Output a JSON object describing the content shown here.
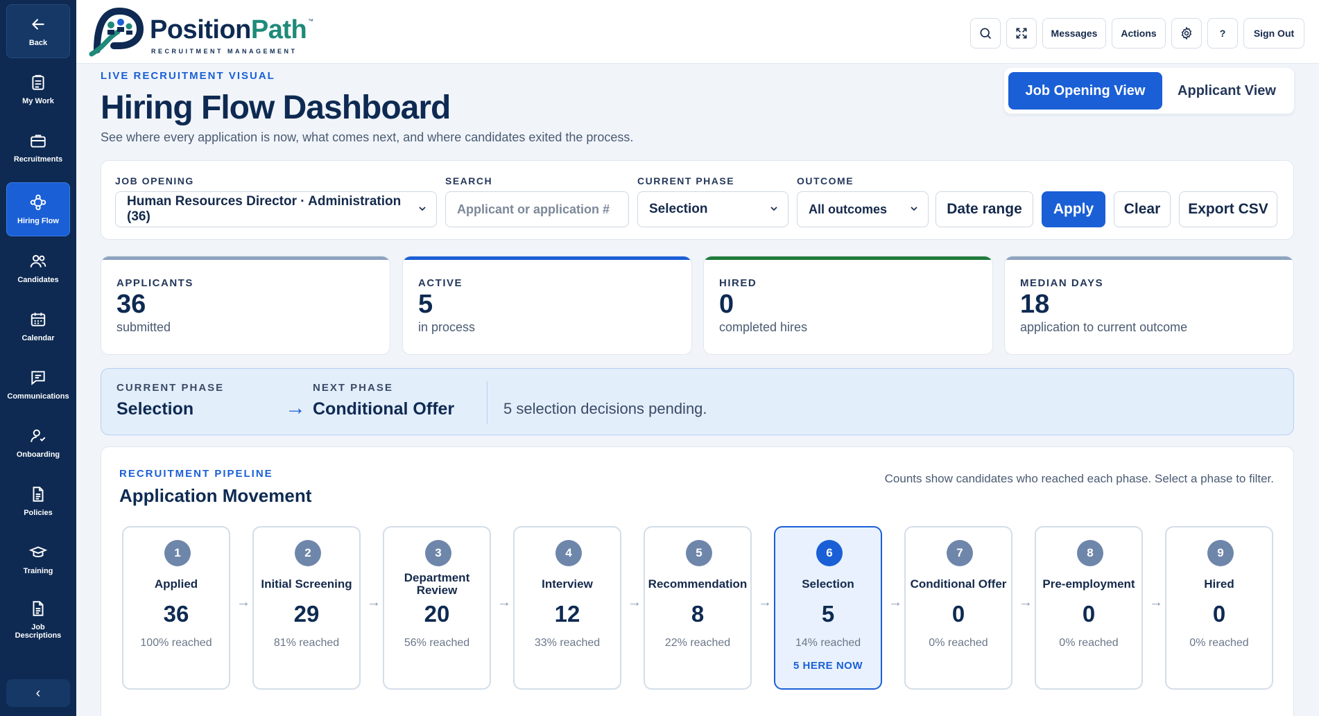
{
  "brand": {
    "name_part1": "Position",
    "name_part2": "Path",
    "trademark": "™",
    "tagline": "RECRUITMENT MANAGEMENT",
    "colors": {
      "navy": "#0e2a52",
      "teal": "#1f8a7a",
      "accent_blue": "#1a5fd6"
    }
  },
  "sidebar": {
    "items": [
      {
        "label": "Back",
        "icon": "arrow-left-icon"
      },
      {
        "label": "My Work",
        "icon": "clipboard-icon"
      },
      {
        "label": "Recruitments",
        "icon": "briefcase-icon"
      },
      {
        "label": "Hiring Flow",
        "icon": "flow-nodes-icon",
        "active": true
      },
      {
        "label": "Candidates",
        "icon": "users-icon"
      },
      {
        "label": "Calendar",
        "icon": "calendar-icon"
      },
      {
        "label": "Communications",
        "icon": "chat-icon"
      },
      {
        "label": "Onboarding",
        "icon": "user-check-icon"
      },
      {
        "label": "Policies",
        "icon": "document-icon"
      },
      {
        "label": "Training",
        "icon": "graduation-cap-icon"
      },
      {
        "label": "Job Descriptions",
        "icon": "document-icon"
      }
    ],
    "collapse_glyph": "‹"
  },
  "header": {
    "messages_label": "Messages",
    "actions_label": "Actions",
    "help_label": "?",
    "signout_label": "Sign Out"
  },
  "page": {
    "eyebrow": "LIVE RECRUITMENT VISUAL",
    "title": "Hiring Flow Dashboard",
    "subtitle": "See where every application is now, what comes next, and where candidates exited the process."
  },
  "view_toggle": {
    "active": "Job Opening View",
    "inactive": "Applicant View"
  },
  "filters": {
    "job_opening_label": "JOB OPENING",
    "job_opening_value": "Human Resources Director · Administration (36)",
    "search_label": "SEARCH",
    "search_placeholder": "Applicant or application #",
    "phase_label": "CURRENT PHASE",
    "phase_value": "Selection",
    "outcome_label": "OUTCOME",
    "outcome_value": "All outcomes",
    "date_range_label": "Date range",
    "apply_label": "Apply",
    "clear_label": "Clear",
    "export_label": "Export CSV"
  },
  "stats": [
    {
      "label": "APPLICANTS",
      "value": "36",
      "sub": "submitted",
      "color": "#8fa3bf"
    },
    {
      "label": "ACTIVE",
      "value": "5",
      "sub": "in process",
      "color": "#1a5fd6"
    },
    {
      "label": "HIRED",
      "value": "0",
      "sub": "completed hires",
      "color": "#1f7a3a"
    },
    {
      "label": "MEDIAN DAYS",
      "value": "18",
      "sub": "application to current outcome",
      "color": "#8fa3bf"
    }
  ],
  "phase_banner": {
    "current_label": "CURRENT PHASE",
    "current_value": "Selection",
    "arrow": "→",
    "next_label": "NEXT PHASE",
    "next_value": "Conditional Offer",
    "note": "5 selection decisions pending."
  },
  "pipeline": {
    "eyebrow": "RECRUITMENT PIPELINE",
    "title": "Application Movement",
    "hint": "Counts show candidates who reached each phase. Select a phase to filter.",
    "arrow": "→",
    "stages": [
      {
        "num": "1",
        "name": "Applied",
        "count": "36",
        "pct": "100% reached"
      },
      {
        "num": "2",
        "name": "Initial Screening",
        "count": "29",
        "pct": "81% reached"
      },
      {
        "num": "3",
        "name": "Department Review",
        "count": "20",
        "pct": "56% reached"
      },
      {
        "num": "4",
        "name": "Interview",
        "count": "12",
        "pct": "33% reached"
      },
      {
        "num": "5",
        "name": "Recommendation",
        "count": "8",
        "pct": "22% reached"
      },
      {
        "num": "6",
        "name": "Selection",
        "count": "5",
        "pct": "14% reached",
        "here": "5 HERE NOW",
        "current": true
      },
      {
        "num": "7",
        "name": "Conditional Offer",
        "count": "0",
        "pct": "0% reached"
      },
      {
        "num": "8",
        "name": "Pre-employment",
        "count": "0",
        "pct": "0% reached"
      },
      {
        "num": "9",
        "name": "Hired",
        "count": "0",
        "pct": "0% reached"
      }
    ]
  }
}
